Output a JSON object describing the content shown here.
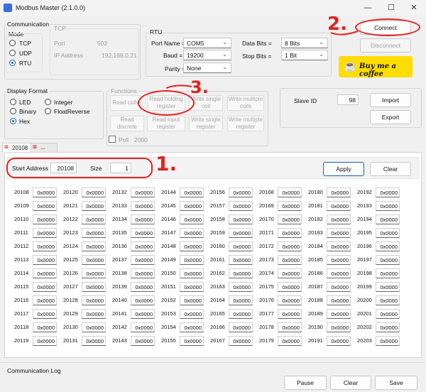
{
  "window": {
    "title": "Modbus Master (2.1.0.0)"
  },
  "communication": {
    "label": "Communication",
    "mode_label": "Mode",
    "modes": [
      "TCP",
      "UDP",
      "RTU"
    ],
    "selected_mode": "RTU"
  },
  "tcp": {
    "label": "TCP",
    "port_label": "Port",
    "port_value": "502",
    "ip_label": "IP Address",
    "ip_value": "192.168.0.21"
  },
  "rtu": {
    "label": "RTU",
    "port_name_label": "Port Name =",
    "port_name": "COM5",
    "baud_label": "Baud =",
    "baud": "19200",
    "parity_label": "Parity =",
    "parity": "None",
    "data_bits_label": "Data Bits =",
    "data_bits": "8 Bits",
    "stop_bits_label": "Stop Bits =",
    "stop_bits": "1 Bit"
  },
  "actions": {
    "connect": "Connect",
    "disconnect": "Disconnect",
    "coffee": "Buy me a coffee"
  },
  "display_format": {
    "label": "Display Format",
    "options": [
      "LED",
      "Integer",
      "Binary",
      "FloatReverse",
      "Hex"
    ],
    "selected": "Hex"
  },
  "functions": {
    "label": "Functions",
    "buttons": [
      "Read coils",
      "Read holding register",
      "Write single coil",
      "Write multiple coils",
      "Read discrete",
      "Read input register",
      "Write single register",
      "Write multiple register"
    ],
    "poll_label": "Poll",
    "poll_value": "2000"
  },
  "slave": {
    "label": "Slave ID",
    "value": "98",
    "import": "Import",
    "export": "Export"
  },
  "tabs": [
    {
      "label": "20108"
    },
    {
      "label": "..."
    }
  ],
  "registers_panel": {
    "start_label": "Start Address",
    "start_value": "20108",
    "size_label": "Size",
    "size_value": "1",
    "apply": "Apply",
    "clear": "Clear"
  },
  "registers": [
    [
      "20108",
      "20120",
      "20132",
      "20144",
      "20156",
      "20168",
      "20180",
      "20192"
    ],
    [
      "20109",
      "20121",
      "20133",
      "20145",
      "20157",
      "20169",
      "20181",
      "20193"
    ],
    [
      "20110",
      "20122",
      "20134",
      "20146",
      "20158",
      "20170",
      "20182",
      "20194"
    ],
    [
      "20111",
      "20123",
      "20135",
      "20147",
      "20159",
      "20171",
      "20183",
      "20195"
    ],
    [
      "20112",
      "20124",
      "20136",
      "20148",
      "20160",
      "20172",
      "20184",
      "20196"
    ],
    [
      "20113",
      "20125",
      "20137",
      "20149",
      "20161",
      "20173",
      "20185",
      "20197"
    ],
    [
      "20114",
      "20126",
      "20138",
      "20150",
      "20162",
      "20174",
      "20186",
      "20198"
    ],
    [
      "20115",
      "20127",
      "20139",
      "20151",
      "20163",
      "20175",
      "20187",
      "20199"
    ],
    [
      "20116",
      "20128",
      "20140",
      "20152",
      "20164",
      "20176",
      "20188",
      "20200"
    ],
    [
      "20117",
      "20129",
      "20141",
      "20153",
      "20165",
      "20177",
      "20189",
      "20201"
    ],
    [
      "20118",
      "20130",
      "20142",
      "20154",
      "20166",
      "20178",
      "20190",
      "20202"
    ],
    [
      "20119",
      "20131",
      "20143",
      "20155",
      "20167",
      "20179",
      "20191",
      "20203"
    ]
  ],
  "register_value": "0x0000",
  "log": {
    "label": "Communication Log",
    "pause": "Pause",
    "clear": "Clear",
    "save": "Save"
  },
  "annotations": {
    "one": "1.",
    "two": "2.",
    "three": "3."
  },
  "colors": {
    "annotation": "#e2221f",
    "coffee_bg": "#ffdd00",
    "accent": "#1a5fb4"
  }
}
